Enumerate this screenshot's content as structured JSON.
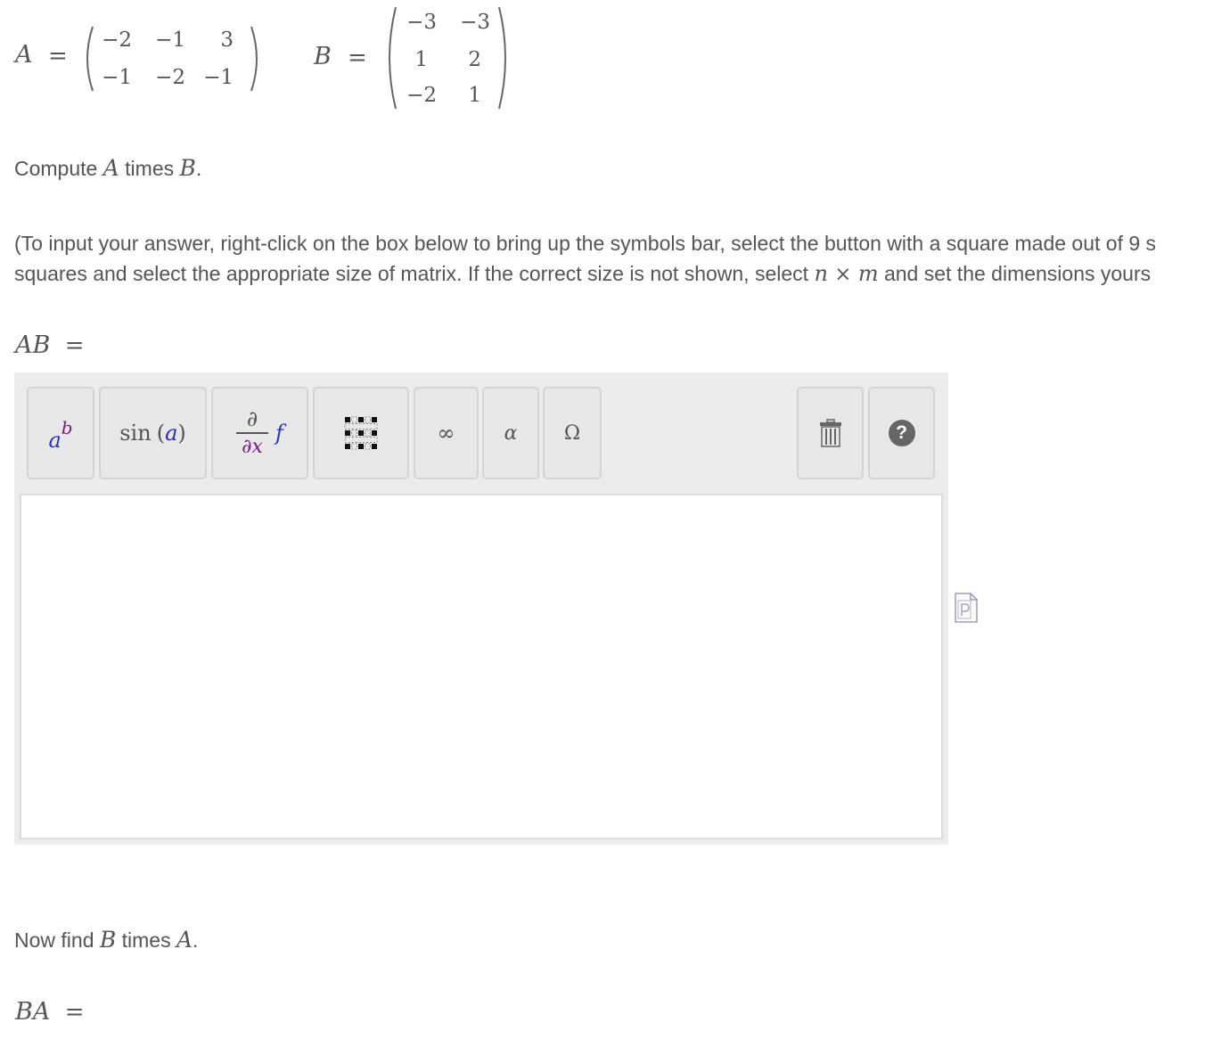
{
  "matrix_a": {
    "label": "A",
    "equals": "=",
    "rows": [
      [
        "−2",
        "−1",
        "3"
      ],
      [
        "−1",
        "−2",
        "−1"
      ]
    ]
  },
  "matrix_b": {
    "label": "B",
    "equals": "=",
    "rows": [
      [
        "−3",
        "−3"
      ],
      [
        "1",
        "2"
      ],
      [
        "−2",
        "1"
      ]
    ]
  },
  "prompt1": {
    "prefix": "Compute ",
    "var1": "A",
    "middle": " times ",
    "var2": "B",
    "suffix": "."
  },
  "instructions": {
    "line1": "(To input your answer, right-click on the box below to bring up the symbols bar, select the button with a square made out of 9 s",
    "line2_a": "squares and select the appropriate size of matrix. If the correct size is not shown, select ",
    "n": "n",
    "times": " × ",
    "m": "m",
    "line2_b": " and set the dimensions yours"
  },
  "answer1": {
    "label": "AB",
    "equals": "="
  },
  "toolbar": {
    "power_base": "a",
    "power_exp": "b",
    "sin_fn": "sin",
    "sin_arg": "a",
    "deriv_top": "∂",
    "deriv_bottom": "∂x",
    "deriv_f": "f",
    "infinity": "∞",
    "alpha": "α",
    "omega": "Ω",
    "help": "?"
  },
  "prompt2": {
    "prefix": "Now find ",
    "var1": "B",
    "middle": " times ",
    "var2": "A",
    "suffix": "."
  },
  "answer2": {
    "label": "BA",
    "equals": "="
  },
  "colors": {
    "base_var": "#2a33c4",
    "exp_var": "#7a1a8a",
    "func_var": "#2a2ac8",
    "help_bg": "#666666"
  }
}
